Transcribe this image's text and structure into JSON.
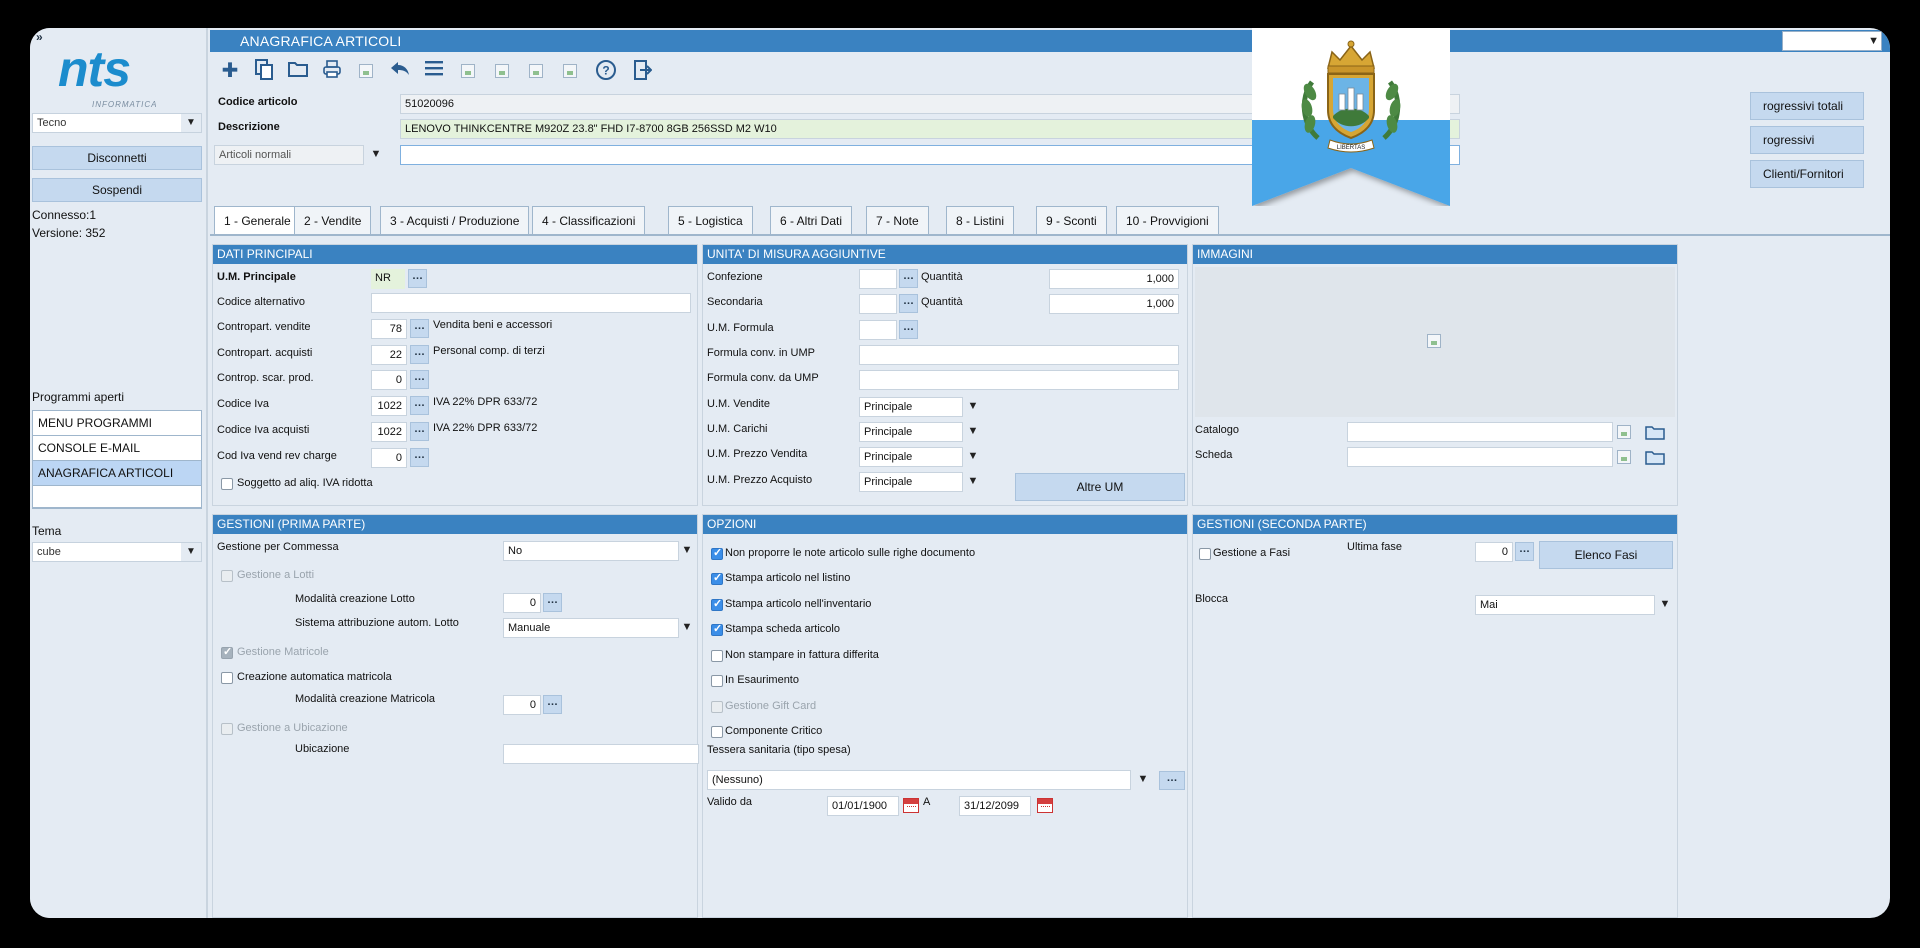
{
  "app": {
    "window_title": "ANAGRAFICA ARTICOLI",
    "logo_text": "nts",
    "logo_sub": "INFORMATICA",
    "collapse_glyph": "»"
  },
  "sidebar": {
    "company_select": "Tecno",
    "disconnect_label": "Disconnetti",
    "suspend_label": "Sospendi",
    "connected_text": "Connesso:1",
    "version_text": "Versione: 352",
    "open_programs_label": "Programmi aperti",
    "open_programs": [
      "MENU PROGRAMMI",
      "CONSOLE E-MAIL",
      "ANAGRAFICA ARTICOLI"
    ],
    "theme_label": "Tema",
    "theme_value": "cube"
  },
  "toolbar": {
    "icons": [
      "add-icon",
      "copy-icon",
      "open-folder-icon",
      "print-icon",
      "image-placeholder-icon",
      "undo-icon",
      "list-menu-icon",
      "image-placeholder-icon",
      "image-placeholder-icon",
      "image-placeholder-icon",
      "image-placeholder-icon",
      "help-icon",
      "exit-icon"
    ]
  },
  "header": {
    "code_label": "Codice articolo",
    "code_value": "51020096",
    "desc_label": "Descrizione",
    "desc_value": "LENOVO THINKCENTRE M920Z 23.8\" FHD I7-8700 8GB 256SSD M2 W10",
    "type_select": "Articoli normali",
    "right_buttons": [
      "rogressivi totali",
      "rogressivi",
      "Clienti/Fornitori"
    ]
  },
  "tabs": [
    "1 - Generale",
    "2 - Vendite",
    "3 - Acquisti / Produzione",
    "4 - Classificazioni",
    "5 - Logistica",
    "6 - Altri Dati",
    "7 - Note",
    "8 - Listini",
    "9 - Sconti",
    "10 - Provvigioni"
  ],
  "dati_principali": {
    "title": "DATI PRINCIPALI",
    "um_label": "U.M. Principale",
    "um_value": "NR",
    "cod_alt_label": "Codice alternativo",
    "cv_label": "Contropart. vendite",
    "cv_value": "78",
    "cv_desc": "Vendita beni e accessori",
    "ca_label": "Contropart. acquisti",
    "ca_value": "22",
    "ca_desc": "Personal comp. di terzi",
    "csp_label": "Controp. scar. prod.",
    "csp_value": "0",
    "iva_label": "Codice Iva",
    "iva_value": "1022",
    "iva_desc": "IVA 22% DPR 633/72",
    "ivaa_label": "Codice Iva acquisti",
    "ivaa_value": "1022",
    "ivaa_desc": "IVA 22% DPR 633/72",
    "ivarc_label": "Cod Iva vend rev charge",
    "ivarc_value": "0",
    "sogg_label": "Soggetto ad aliq. IVA ridotta"
  },
  "unita_misura": {
    "title": "UNITA' DI MISURA AGGIUNTIVE",
    "conf_label": "Confezione",
    "qty_label": "Quantità",
    "qty1": "1,000",
    "sec_label": "Secondaria",
    "qty2": "1,000",
    "umf_label": "U.M. Formula",
    "fump_label": "Formula conv. in UMP",
    "fdump_label": "Formula conv. da UMP",
    "umv_label": "U.M. Vendite",
    "umv_value": "Principale",
    "umc_label": "U.M. Carichi",
    "umc_value": "Principale",
    "umpv_label": "U.M. Prezzo Vendita",
    "umpv_value": "Principale",
    "umpa_label": "U.M. Prezzo Acquisto",
    "umpa_value": "Principale",
    "altre_um": "Altre UM"
  },
  "immagini": {
    "title": "IMMAGINI",
    "catalogo_label": "Catalogo",
    "scheda_label": "Scheda"
  },
  "gestioni1": {
    "title": "GESTIONI (PRIMA PARTE)",
    "commessa_label": "Gestione per Commessa",
    "commessa_value": "No",
    "lotti_label": "Gestione a Lotti",
    "mod_lotto_label": "Modalità creazione Lotto",
    "mod_lotto_value": "0",
    "sist_lotto_label": "Sistema attribuzione autom. Lotto",
    "sist_lotto_value": "Manuale",
    "matricole_label": "Gestione Matricole",
    "crea_matr_label": "Creazione automatica matricola",
    "mod_matr_label": "Modalità creazione Matricola",
    "mod_matr_value": "0",
    "ubic_label": "Gestione a Ubicazione",
    "ubicazione_label": "Ubicazione"
  },
  "opzioni": {
    "title": "OPZIONI",
    "items": [
      {
        "label": "Non proporre le note articolo sulle righe documento",
        "checked": true
      },
      {
        "label": "Stampa articolo nel listino",
        "checked": true
      },
      {
        "label": "Stampa articolo nell'inventario",
        "checked": true
      },
      {
        "label": "Stampa scheda articolo",
        "checked": true
      },
      {
        "label": "Non stampare in fattura differita",
        "checked": false
      },
      {
        "label": "In Esaurimento",
        "checked": false
      },
      {
        "label": "Gestione Gift Card",
        "checked": false
      },
      {
        "label": "Componente Critico",
        "checked": false
      }
    ],
    "tessera_label": "Tessera sanitaria (tipo spesa)",
    "tessera_value": "(Nessuno)",
    "valido_label": "Valido da",
    "valido_da": "01/01/1900",
    "a_label": "A",
    "valido_a": "31/12/2099"
  },
  "gestioni2": {
    "title": "GESTIONI (SECONDA PARTE)",
    "fasi_label": "Gestione a Fasi",
    "ultima_fase_label": "Ultima fase",
    "ultima_fase_value": "0",
    "elenco_fasi": "Elenco Fasi",
    "blocca_label": "Blocca",
    "blocca_value": "Mai"
  },
  "flag": {
    "motto": "LIBERTAS",
    "colors": {
      "top": "#ffffff",
      "bottom": "#4aa6e8",
      "gold": "#d7a634",
      "green": "#3f7a3a"
    }
  },
  "colors": {
    "header_blue": "#3a82c1",
    "button_blue": "#c5d9ef",
    "panel_bg": "#e4ebf3"
  }
}
